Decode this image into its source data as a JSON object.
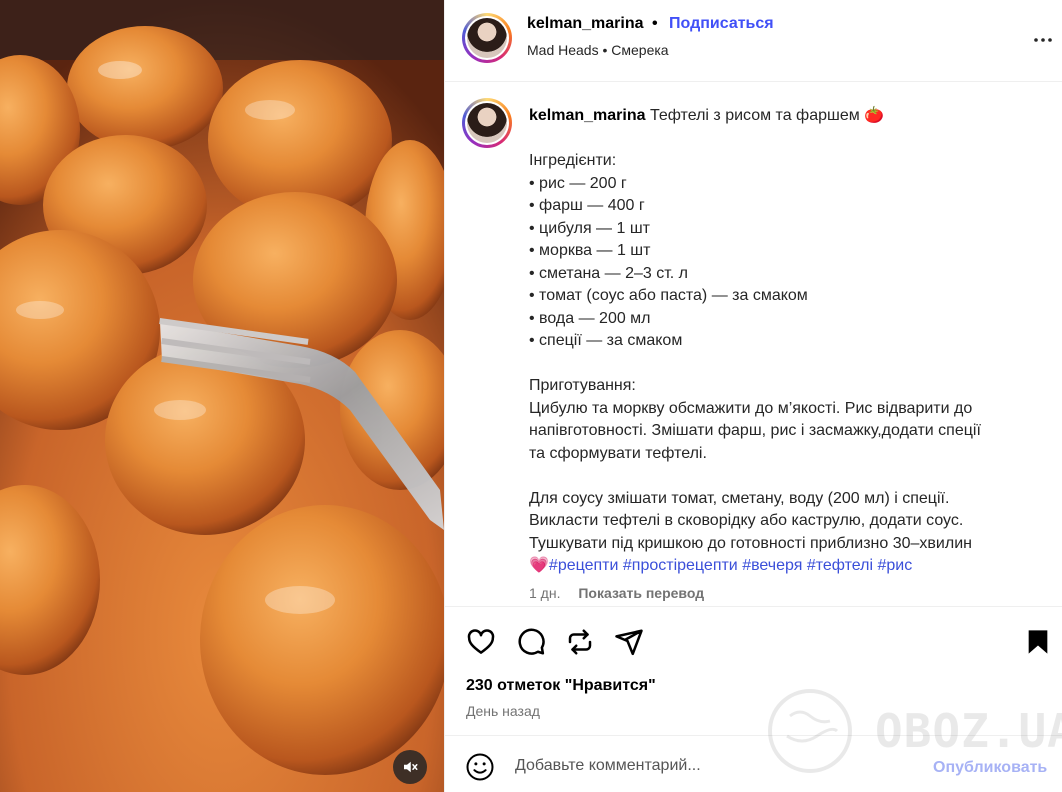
{
  "post": {
    "author": {
      "username": "kelman_marina",
      "follow_label": "Подписаться",
      "separator": "•",
      "audio": "Mad Heads • Смерека"
    },
    "caption": {
      "title": "Тефтелі з рисом та фаршем 🍅",
      "ingredients_heading": "Інгредієнти:",
      "ingredients": [
        "• рис — 200 г",
        "• фарш — 400 г",
        "• цибуля — 1 шт",
        "• морква — 1 шт",
        "• сметана — 2–3 ст. л",
        "• томат (соус або паста) — за смаком",
        "• вода — 200 мл",
        "• спеції — за смаком"
      ],
      "steps_heading": "Приготування:",
      "steps_lines": [
        "Цибулю та моркву обсмажити до м’якості. Рис відварити до",
        "напівготовності. Змішати фарш, рис і засмажку,додати спеції",
        "та сформувати тефтелі."
      ],
      "sauce_lines": [
        "Для соусу змішати томат, сметану, воду (200 мл) і спеції.",
        "Викласти тефтелі в сковорідку або каструлю, додати соус.",
        "Тушкувати під кришкою до готовності приблизно 30–хвилин"
      ],
      "heart_emoji": "💗",
      "hashtags": [
        "#рецепти",
        "#простірецепти",
        "#вечеря",
        "#тефтелі",
        "#рис"
      ],
      "age": "1 дн.",
      "translate_label": "Показать перевод"
    },
    "actions": {
      "icons": [
        "heart-icon",
        "comment-icon",
        "repost-icon",
        "share-icon",
        "bookmark-icon"
      ]
    },
    "likes": "230 отметок \"Нравится\"",
    "posted": "День назад",
    "comment": {
      "placeholder": "Добавьте комментарий...",
      "post_label": "Опубликовать"
    },
    "watermark": "OBOZ.UA"
  }
}
